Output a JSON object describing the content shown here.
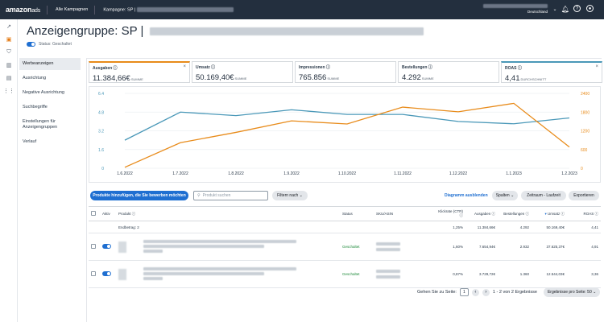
{
  "topbar": {
    "logo_main": "amazon",
    "logo_sub": "ads",
    "all_campaigns": "Alle Kampagnen",
    "campaign_prefix": "Kampagne: SP |",
    "account_region": "Deutschland"
  },
  "header": {
    "title_bold": "Anzeigengruppe: SP |",
    "status": "Status: Geschaltet"
  },
  "sidebar": {
    "items": [
      "Werbeanzeigen",
      "Ausrichtung",
      "Negative Ausrichtung",
      "Suchbegriffe",
      "Einstellungen für Anzeigengruppen",
      "Verlauf"
    ]
  },
  "metrics": [
    {
      "label": "Ausgaben",
      "value": "11.384,66€",
      "unit": "SUMME",
      "color": "#e88b1a"
    },
    {
      "label": "Umsatz",
      "value": "50.169,40€",
      "unit": "SUMME"
    },
    {
      "label": "Impressionen",
      "value": "765.856",
      "unit": "SUMME"
    },
    {
      "label": "Bestellungen",
      "value": "4.292",
      "unit": "SUMME"
    },
    {
      "label": "ROAS",
      "value": "4,41",
      "unit": "DURCHSCHNITT",
      "color": "#4a98b8"
    }
  ],
  "chart_data": {
    "type": "line",
    "x": [
      "1.6.2022",
      "1.7.2022",
      "1.8.2022",
      "1.9.2022",
      "1.10.2022",
      "1.11.2022",
      "1.12.2022",
      "1.1.2023",
      "1.2.2023"
    ],
    "y_left_ticks": [
      "6.4",
      "4.8",
      "3.2",
      "1.6",
      "0"
    ],
    "y_right_ticks": [
      "2400",
      "1800",
      "1200",
      "600",
      "0"
    ],
    "ylim_left": [
      0,
      6.4
    ],
    "ylim_right": [
      0,
      2400
    ],
    "series": [
      {
        "name": "ROAS",
        "axis": "left",
        "color": "#4a98b8",
        "values": [
          2.4,
          4.8,
          4.5,
          5.0,
          4.6,
          4.6,
          4.0,
          3.8,
          4.3
        ]
      },
      {
        "name": "Ausgaben",
        "axis": "right",
        "color": "#e88b1a",
        "values": [
          30,
          820,
          1150,
          1520,
          1420,
          1960,
          1810,
          2080,
          680
        ]
      }
    ]
  },
  "toolbar": {
    "add_products": "Produkte hinzufügen, die Sie bewerben möchten",
    "search_placeholder": "Produkt suchen",
    "filter": "Filtern nach",
    "hide_chart": "Diagramm ausblenden",
    "columns": "Spalten",
    "date_range": "Zeitraum - Laufzeit",
    "export": "Exportieren"
  },
  "table": {
    "headers": [
      "Aktiv",
      "Produkt",
      "Status",
      "SKU/ASIN",
      "Klickrate (CTR)",
      "Ausgaben",
      "Bestellungen",
      "Umsatz",
      "ROAS"
    ],
    "total": {
      "label": "Endbetrag: 2",
      "ctr": "1,25%",
      "spend": "11.384,66€",
      "orders": "4.292",
      "sales": "50.169,40€",
      "roas": "4,41"
    },
    "rows": [
      {
        "status": "Geschaltet",
        "ctr": "1,60%",
        "spend": "7.654,94€",
        "orders": "2.932",
        "sales": "37.625,37€",
        "roas": "4,91"
      },
      {
        "status": "Geschaltet",
        "ctr": "0,87%",
        "spend": "3.729,72€",
        "orders": "1.360",
        "sales": "12.544,03€",
        "roas": "3,36"
      }
    ]
  },
  "pagination": {
    "goto_label": "Gehen Sie zu Seite:",
    "page": "1",
    "range": "1 - 2 von 2 Ergebnisse",
    "per_page": "Ergebnisse pro Seite: 50"
  }
}
